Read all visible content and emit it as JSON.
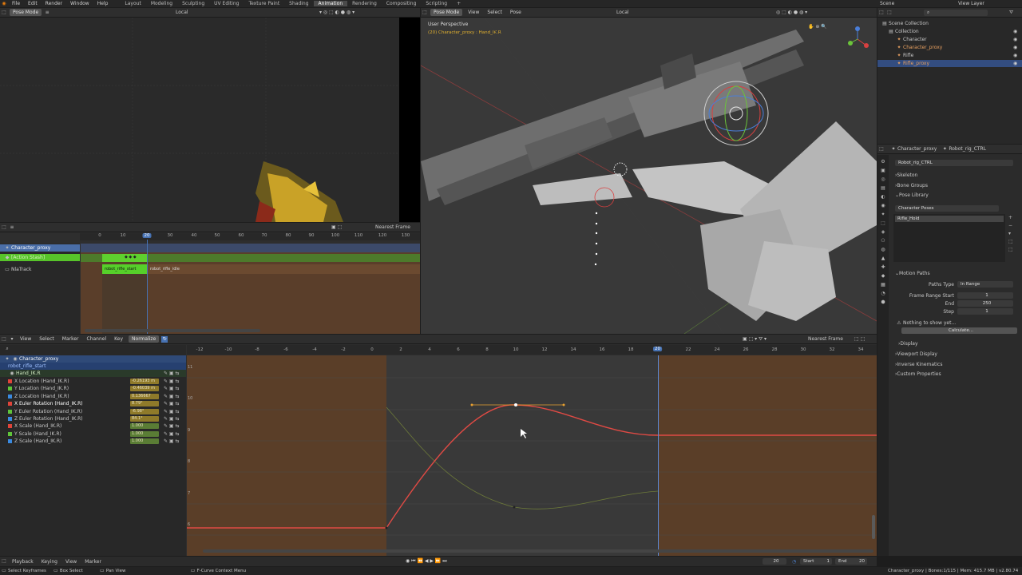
{
  "topbar": {
    "menus": [
      "File",
      "Edit",
      "Render",
      "Window",
      "Help"
    ],
    "workspaces": [
      "Layout",
      "Modeling",
      "Sculpting",
      "UV Editing",
      "Texture Paint",
      "Shading",
      "Animation",
      "Rendering",
      "Compositing",
      "Scripting"
    ],
    "active_workspace": "Animation",
    "scene": "Scene",
    "view_layer": "View Layer"
  },
  "camview": {
    "mode": "Pose Mode",
    "orientation": "Local"
  },
  "viewport": {
    "mode": "Pose Mode",
    "menus": [
      "View",
      "Select",
      "Pose"
    ],
    "orientation": "Local",
    "overlay_title": "User Perspective",
    "overlay_sub": "(20) Character_proxy : Hand_IK.R"
  },
  "nla": {
    "snap": "Nearest Frame",
    "ticks": [
      "0",
      "10",
      "20",
      "30",
      "40",
      "50",
      "60",
      "70",
      "80",
      "90",
      "100",
      "110",
      "120",
      "130"
    ],
    "current_frame": "20",
    "tracks": [
      {
        "name": "Character_proxy"
      },
      {
        "name": "[Action Stash]"
      },
      {
        "name": "NlaTrack"
      }
    ],
    "strip1": "robot_rifle_start",
    "strip2": "robot_rifle_idle"
  },
  "graph": {
    "menus": [
      "View",
      "Select",
      "Marker",
      "Channel",
      "Key"
    ],
    "normalize": "Normalize",
    "snap": "Nearest Frame",
    "ticks": [
      "-12",
      "-10",
      "-8",
      "-6",
      "-4",
      "-2",
      "0",
      "2",
      "4",
      "6",
      "8",
      "10",
      "12",
      "14",
      "16",
      "18",
      "20",
      "22",
      "24",
      "26",
      "28",
      "30",
      "32",
      "34"
    ],
    "current_frame": "20",
    "y_ticks": [
      "11",
      "10",
      "9",
      "8",
      "7",
      "6"
    ],
    "object": "Character_proxy",
    "action": "robot_rifle_start",
    "group": "Hand_IK.R",
    "channels": [
      {
        "name": "X Location (Hand_IK.R)",
        "value": "-0.26193 m",
        "color": "#e0443a"
      },
      {
        "name": "Y Location (Hand_IK.R)",
        "value": "-0.46039 m",
        "color": "#5fc43a"
      },
      {
        "name": "Z Location (Hand_IK.R)",
        "value": "0.136667",
        "color": "#3a8ae0"
      },
      {
        "name": "X Euler Rotation (Hand_IK.R)",
        "value": "8.79°",
        "color": "#e0443a"
      },
      {
        "name": "Y Euler Rotation (Hand_IK.R)",
        "value": "-6.98°",
        "color": "#5fc43a"
      },
      {
        "name": "Z Euler Rotation (Hand_IK.R)",
        "value": "84.1°",
        "color": "#3a8ae0"
      },
      {
        "name": "X Scale (Hand_IK.R)",
        "value": "1.000",
        "color": "#e0443a"
      },
      {
        "name": "Y Scale (Hand_IK.R)",
        "value": "1.000",
        "color": "#5fc43a"
      },
      {
        "name": "Z Scale (Hand_IK.R)",
        "value": "1.000",
        "color": "#3a8ae0"
      }
    ]
  },
  "outliner": {
    "items": [
      {
        "name": "Scene Collection"
      },
      {
        "name": "Collection"
      },
      {
        "name": "Character"
      },
      {
        "name": "Character_proxy"
      },
      {
        "name": "Rifle"
      },
      {
        "name": "Rifle_proxy"
      }
    ]
  },
  "properties": {
    "object": "Character_proxy",
    "armature": "Robot_rig_CTRL",
    "data_name": "Robot_rig_CTRL",
    "sections": [
      "Skeleton",
      "Bone Groups",
      "Pose Library"
    ],
    "pose_library": "Character Poses",
    "pose_item": "Rifle_Hold",
    "motion_paths": "Motion Paths",
    "paths_type_label": "Paths Type",
    "paths_type": "In Range",
    "frame_range_start_label": "Frame Range Start",
    "frame_range_start": "1",
    "end_label": "End",
    "end": "250",
    "step_label": "Step",
    "step": "1",
    "nothing": "Nothing to show yet...",
    "calculate": "Calculate...",
    "more_sections": [
      "Display",
      "Viewport Display",
      "Inverse Kinematics",
      "Custom Properties"
    ]
  },
  "playback": {
    "menus": [
      "Playback",
      "Keying",
      "View",
      "Marker"
    ],
    "frame": "20",
    "start_label": "Start",
    "start": "1",
    "end_label": "End",
    "end": "20"
  },
  "statusbar": {
    "hints": [
      "Select Keyframes",
      "Box Select",
      "Pan View",
      "F-Curve Context Menu"
    ],
    "info": "Character_proxy | Bones:1/115 | Mem: 415.7 MB | v2.80.74"
  }
}
